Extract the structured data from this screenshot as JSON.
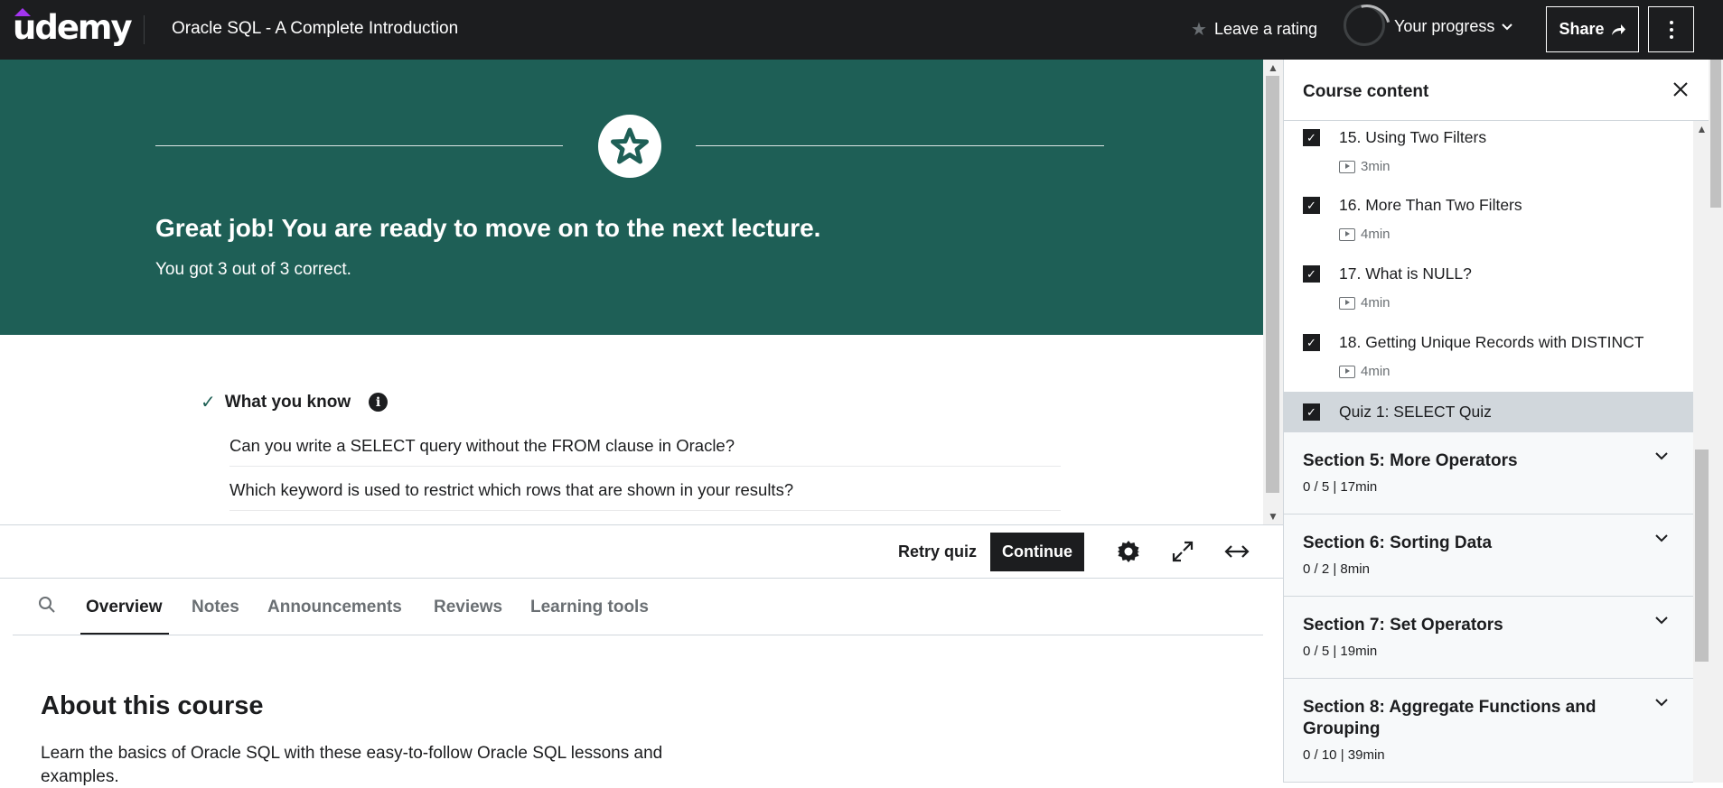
{
  "header": {
    "logo": "udemy",
    "course_title": "Oracle SQL - A Complete Introduction",
    "rating_label": "Leave a rating",
    "progress_label": "Your progress",
    "share_label": "Share"
  },
  "quiz": {
    "banner_title": "Great job! You are ready to move on to the next lecture.",
    "banner_subtitle": "You got 3 out of 3 correct.",
    "know_heading": "What you know",
    "questions": [
      "Can you write a SELECT query without the FROM clause in Oracle?",
      "Which keyword is used to restrict which rows that are shown in your results?"
    ],
    "retry_label": "Retry quiz",
    "continue_label": "Continue"
  },
  "tabs": [
    "Overview",
    "Notes",
    "Announcements",
    "Reviews",
    "Learning tools"
  ],
  "about": {
    "title": "About this course",
    "text": "Learn the basics of Oracle SQL with these easy-to-follow Oracle SQL lessons and examples."
  },
  "sidebar": {
    "title": "Course content",
    "lectures": [
      {
        "title": "15. Using Two Filters",
        "duration": "3min"
      },
      {
        "title": "16. More Than Two Filters",
        "duration": "4min"
      },
      {
        "title": "17. What is NULL?",
        "duration": "4min"
      },
      {
        "title": "18. Getting Unique Records with DISTINCT",
        "duration": "4min"
      },
      {
        "title": "Quiz 1: SELECT Quiz",
        "duration": ""
      }
    ],
    "sections": [
      {
        "title": "Section 5: More Operators",
        "meta": "0 / 5 | 17min"
      },
      {
        "title": "Section 6: Sorting Data",
        "meta": "0 / 2 | 8min"
      },
      {
        "title": "Section 7: Set Operators",
        "meta": "0 / 5 | 19min"
      },
      {
        "title": "Section 8: Aggregate Functions and Grouping",
        "meta": "0 / 10 | 39min"
      }
    ]
  },
  "colors": {
    "banner": "#1e5f56",
    "topbar": "#1c1d1f",
    "brand_accent": "#a435f0"
  }
}
